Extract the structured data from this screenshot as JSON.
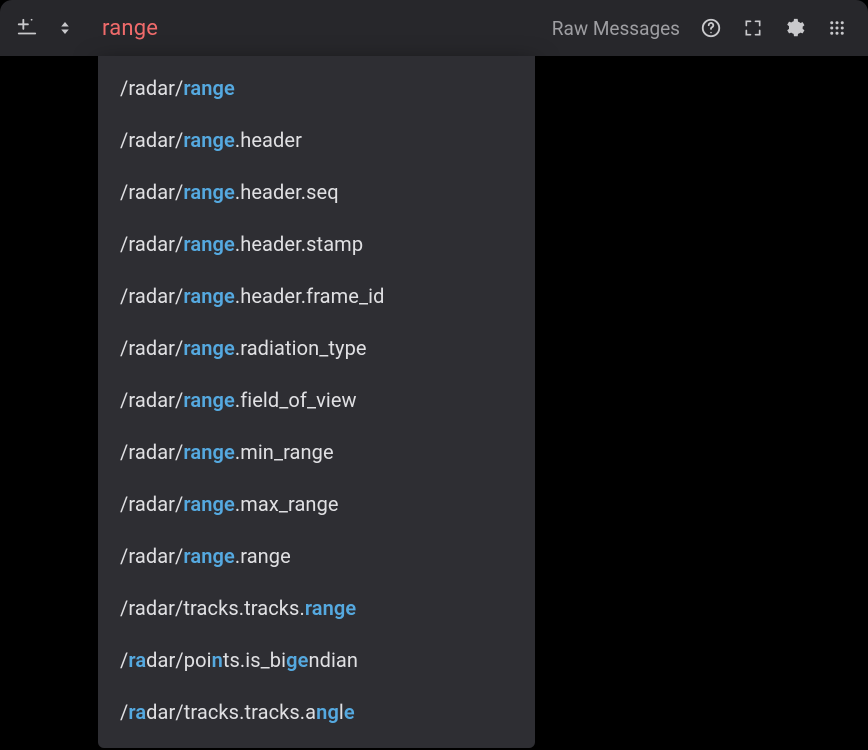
{
  "search": {
    "value": "range"
  },
  "toolbar": {
    "raw_messages_label": "Raw Messages"
  },
  "icons": {
    "diff": "diff-icon",
    "sort": "sort-icon",
    "help": "help-circle-icon",
    "expand": "expand-icon",
    "settings": "gear-icon",
    "grid": "grid-icon"
  },
  "autocomplete": {
    "items": [
      {
        "segments": [
          {
            "t": "/radar/",
            "hl": false
          },
          {
            "t": "range",
            "hl": true
          }
        ]
      },
      {
        "segments": [
          {
            "t": "/radar/",
            "hl": false
          },
          {
            "t": "range",
            "hl": true
          },
          {
            "t": ".header",
            "hl": false
          }
        ]
      },
      {
        "segments": [
          {
            "t": "/radar/",
            "hl": false
          },
          {
            "t": "range",
            "hl": true
          },
          {
            "t": ".header.seq",
            "hl": false
          }
        ]
      },
      {
        "segments": [
          {
            "t": "/radar/",
            "hl": false
          },
          {
            "t": "range",
            "hl": true
          },
          {
            "t": ".header.stamp",
            "hl": false
          }
        ]
      },
      {
        "segments": [
          {
            "t": "/radar/",
            "hl": false
          },
          {
            "t": "range",
            "hl": true
          },
          {
            "t": ".header.frame_id",
            "hl": false
          }
        ]
      },
      {
        "segments": [
          {
            "t": "/radar/",
            "hl": false
          },
          {
            "t": "range",
            "hl": true
          },
          {
            "t": ".radiation_type",
            "hl": false
          }
        ]
      },
      {
        "segments": [
          {
            "t": "/radar/",
            "hl": false
          },
          {
            "t": "range",
            "hl": true
          },
          {
            "t": ".field_of_view",
            "hl": false
          }
        ]
      },
      {
        "segments": [
          {
            "t": "/radar/",
            "hl": false
          },
          {
            "t": "range",
            "hl": true
          },
          {
            "t": ".min_range",
            "hl": false
          }
        ]
      },
      {
        "segments": [
          {
            "t": "/radar/",
            "hl": false
          },
          {
            "t": "range",
            "hl": true
          },
          {
            "t": ".max_range",
            "hl": false
          }
        ]
      },
      {
        "segments": [
          {
            "t": "/radar/",
            "hl": false
          },
          {
            "t": "range",
            "hl": true
          },
          {
            "t": ".range",
            "hl": false
          }
        ]
      },
      {
        "segments": [
          {
            "t": "/radar/tracks.tracks.",
            "hl": false
          },
          {
            "t": "range",
            "hl": true
          }
        ]
      },
      {
        "segments": [
          {
            "t": "/",
            "hl": false
          },
          {
            "t": "ra",
            "hl": true
          },
          {
            "t": "dar/poi",
            "hl": false
          },
          {
            "t": "n",
            "hl": true
          },
          {
            "t": "ts.is_bi",
            "hl": false
          },
          {
            "t": "ge",
            "hl": true
          },
          {
            "t": "ndian",
            "hl": false
          }
        ]
      },
      {
        "segments": [
          {
            "t": "/",
            "hl": false
          },
          {
            "t": "ra",
            "hl": true
          },
          {
            "t": "dar/tracks.tracks.a",
            "hl": false
          },
          {
            "t": "ng",
            "hl": true
          },
          {
            "t": "l",
            "hl": false
          },
          {
            "t": "e",
            "hl": true
          }
        ]
      }
    ]
  }
}
